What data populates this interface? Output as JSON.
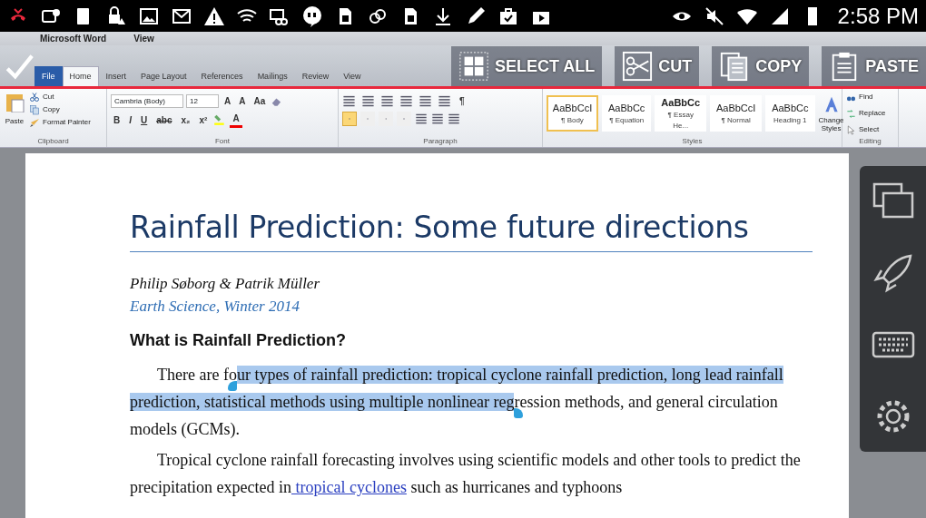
{
  "status_bar": {
    "time": "2:58 PM"
  },
  "word_window": {
    "menu": [
      "Microsoft Word",
      "View"
    ],
    "tabs": [
      {
        "label": "File",
        "selected": false
      },
      {
        "label": "Home",
        "selected": true
      },
      {
        "label": "Insert",
        "selected": false
      },
      {
        "label": "Page Layout",
        "selected": false
      },
      {
        "label": "References",
        "selected": false
      },
      {
        "label": "Mailings",
        "selected": false
      },
      {
        "label": "Review",
        "selected": false
      },
      {
        "label": "View",
        "selected": false
      }
    ],
    "clipboard": {
      "paste": "Paste",
      "items": [
        "Cut",
        "Copy",
        "Format Painter"
      ],
      "label": "Clipboard"
    },
    "font": {
      "face": "Cambria (Body)",
      "size": "12",
      "row1": [
        "A",
        "A",
        "Aa"
      ],
      "row2": [
        "B",
        "I",
        "U",
        "abc",
        "x₂",
        "x²"
      ],
      "color_glyph": "A",
      "label": "Font"
    },
    "paragraph": {
      "pilcrow": "¶",
      "align": [
        {
          "selected": true
        },
        {
          "selected": false
        },
        {
          "selected": false
        },
        {
          "selected": false
        }
      ],
      "label": "Paragraph"
    },
    "styles": {
      "items": [
        {
          "preview": "AaBbCcI",
          "name": "¶ Body",
          "bold": false,
          "selected": true
        },
        {
          "preview": "AaBbCc",
          "name": "¶ Equation",
          "bold": false,
          "selected": false
        },
        {
          "preview": "AaBbCc",
          "name": "¶ Essay He...",
          "bold": true,
          "selected": false
        },
        {
          "preview": "AaBbCcI",
          "name": "¶ Normal",
          "bold": false,
          "selected": false
        },
        {
          "preview": "AaBbCc",
          "name": "Heading 1",
          "bold": false,
          "selected": false
        }
      ],
      "change": "Change Styles",
      "label": "Styles"
    },
    "editing": {
      "items": [
        "Find",
        "Replace",
        "Select"
      ],
      "label": "Editing"
    }
  },
  "action_bar": {
    "buttons": [
      "SELECT ALL",
      "CUT",
      "COPY",
      "PASTE"
    ]
  },
  "document": {
    "title": "Rainfall Prediction: Some future directions",
    "authors": "Philip Søborg & Patrik Müller",
    "affiliation": "Earth Science, Winter 2014",
    "heading": "What is Rainfall Prediction?",
    "paragraphs": [
      {
        "segments": [
          {
            "text": "There are fo",
            "kind": "text",
            "selected": false
          },
          {
            "text": "ur types of rainfall prediction: tropical cyclone rainfall prediction, long lead rainfall prediction, statistical methods using multiple nonlinear reg",
            "kind": "text",
            "selected": true
          },
          {
            "text": "ression methods, and general circulation models (GCMs).",
            "kind": "text",
            "selected": false
          }
        ]
      },
      {
        "segments": [
          {
            "text": "Tropical cyclone rainfall forecasting involves using scientific models and other tools to predict the precipitation expected in",
            "kind": "text",
            "selected": false
          },
          {
            "text": "tropical cyclones",
            "kind": "link",
            "selected": false
          },
          {
            "text": "such as hurricanes and typhoons",
            "kind": "text",
            "selected": false
          }
        ]
      }
    ]
  }
}
